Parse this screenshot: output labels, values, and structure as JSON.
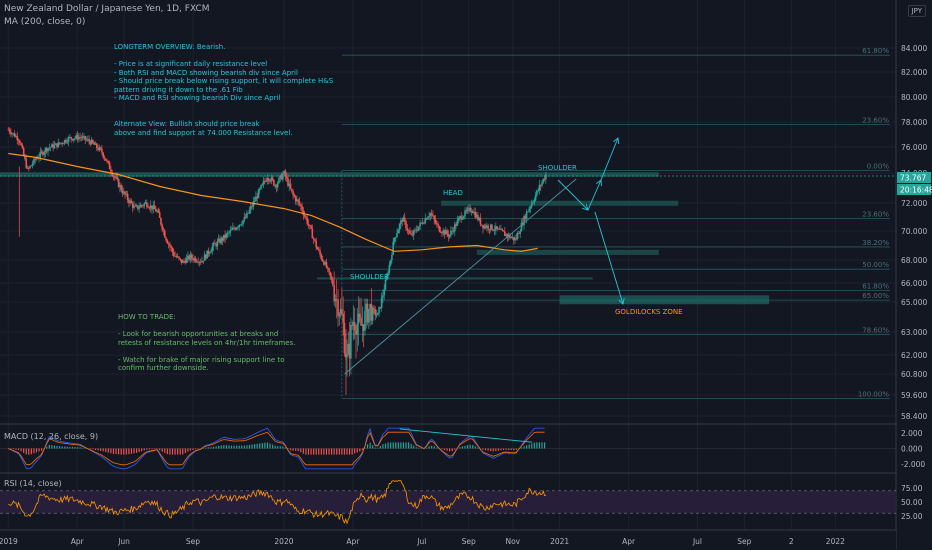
{
  "header": {
    "symbol_title": "New Zealand Dollar / Japanese Yen, 1D, FXCM",
    "ma_label": "MA (200, close, 0)",
    "currency": "JPY"
  },
  "price_axis": {
    "ticks": [
      "84.000",
      "82.000",
      "80.000",
      "78.000",
      "76.000",
      "74.000",
      "72.000",
      "70.000",
      "68.000",
      "66.000",
      "65.000",
      "63.000",
      "62.000",
      "60.800",
      "59.600",
      "58.400"
    ],
    "last_price": "73.767",
    "countdown": "20:16:48"
  },
  "time_axis": [
    "2019",
    "Apr",
    "Jun",
    "Sep",
    "2020",
    "Apr",
    "Jul",
    "Sep",
    "Nov",
    "2021",
    "Apr",
    "Jul",
    "Sep",
    "2",
    "2022"
  ],
  "fib_labels": [
    "61.80%",
    "23.60%",
    "0.00%",
    "23.60%",
    "38.20%",
    "50.00%",
    "61.80%",
    "65.00%",
    "78.60%",
    "100.00%"
  ],
  "annotations": {
    "overview_title": "LONGTERM OVERVIEW: Bearish.",
    "overview_lines": "- Price is at significant daily resistance level\n- Both RSI and MACD showing bearish div since April\n- Should price break below rising support, it will complete H&S\npattern driving it down to the .61 Fib\n- MACD and RSI showing bearish Div since April",
    "alt_view": "Alternate View: Bullish should price break\nabove and find support at 74.000 Resistance level.",
    "how_to_title": "HOW TO TRADE:",
    "how_to_lines": "- Look for bearish opportunities at breaks and\nretests of resistance levels on 4hr/1hr timeframes.\n\n- Watch for brake of major rising support line to\nconfirm further downside.",
    "shoulder_left": "SHOULDER",
    "head": "HEAD",
    "shoulder_right": "SHOULDER",
    "zone": "GOLDILOCKS ZONE"
  },
  "macd": {
    "label": "MACD (12, 26, close, 9)",
    "ticks": [
      "2.000",
      "0.000",
      "-2.000"
    ]
  },
  "rsi": {
    "label": "RSI (14, close)",
    "ticks": [
      "75.00",
      "50.00",
      "25.00"
    ]
  },
  "colors": {
    "background": "#131722",
    "up_candle": "#26a69a",
    "down_candle": "#ef5350",
    "ma": "#f7931a",
    "teal_text": "#26c6da",
    "green_text": "#66bb6a",
    "orange_text": "#ff9800",
    "rsi": "#ff9800",
    "rsi_bg": "#2a1f3d",
    "last_price_bg": "#26a69a",
    "countdown_bg": "#26a69a"
  },
  "chart_data": {
    "type": "candlestick",
    "series": [
      {
        "name": "MA (200, close, 0)",
        "values": []
      }
    ],
    "price_ylim": [
      57.5,
      85.5
    ],
    "price_path": [
      [
        2019.0,
        77.4
      ],
      [
        2019.04,
        76.6
      ],
      [
        2019.07,
        74.2
      ],
      [
        2019.1,
        75.1
      ],
      [
        2019.14,
        75.9
      ],
      [
        2019.18,
        76.2
      ],
      [
        2019.22,
        76.7
      ],
      [
        2019.26,
        76.8
      ],
      [
        2019.3,
        76.4
      ],
      [
        2019.34,
        75.6
      ],
      [
        2019.38,
        73.9
      ],
      [
        2019.42,
        72.6
      ],
      [
        2019.46,
        71.6
      ],
      [
        2019.5,
        72.0
      ],
      [
        2019.54,
        71.4
      ],
      [
        2019.57,
        69.6
      ],
      [
        2019.6,
        68.4
      ],
      [
        2019.63,
        67.8
      ],
      [
        2019.66,
        68.2
      ],
      [
        2019.7,
        67.9
      ],
      [
        2019.74,
        68.9
      ],
      [
        2019.78,
        69.5
      ],
      [
        2019.82,
        70.2
      ],
      [
        2019.86,
        70.9
      ],
      [
        2019.9,
        72.4
      ],
      [
        2019.94,
        73.8
      ],
      [
        2019.97,
        73.2
      ],
      [
        2020.0,
        74.0
      ],
      [
        2020.03,
        72.6
      ],
      [
        2020.06,
        71.8
      ],
      [
        2020.09,
        70.4
      ],
      [
        2020.12,
        68.8
      ],
      [
        2020.15,
        67.6
      ],
      [
        2020.18,
        65.8
      ],
      [
        2020.21,
        64.0
      ],
      [
        2020.23,
        61.5
      ],
      [
        2020.25,
        63.8
      ],
      [
        2020.28,
        63.4
      ],
      [
        2020.31,
        64.6
      ],
      [
        2020.34,
        64.1
      ],
      [
        2020.37,
        66.2
      ],
      [
        2020.4,
        69.5
      ],
      [
        2020.43,
        70.9
      ],
      [
        2020.46,
        69.6
      ],
      [
        2020.5,
        70.6
      ],
      [
        2020.53,
        71.3
      ],
      [
        2020.56,
        70.2
      ],
      [
        2020.6,
        69.7
      ],
      [
        2020.64,
        71.0
      ],
      [
        2020.68,
        71.6
      ],
      [
        2020.72,
        70.4
      ],
      [
        2020.76,
        70.2
      ],
      [
        2020.8,
        69.8
      ],
      [
        2020.84,
        69.4
      ],
      [
        2020.88,
        71.3
      ],
      [
        2020.92,
        72.8
      ],
      [
        2020.95,
        73.9
      ]
    ],
    "ma_path": [
      [
        2019.0,
        75.5
      ],
      [
        2019.1,
        75.2
      ],
      [
        2019.25,
        74.5
      ],
      [
        2019.4,
        73.9
      ],
      [
        2019.55,
        73.1
      ],
      [
        2019.7,
        72.5
      ],
      [
        2019.85,
        72.1
      ],
      [
        2020.0,
        71.6
      ],
      [
        2020.1,
        71.1
      ],
      [
        2020.2,
        70.3
      ],
      [
        2020.3,
        69.4
      ],
      [
        2020.4,
        68.6
      ],
      [
        2020.5,
        68.7
      ],
      [
        2020.6,
        68.9
      ],
      [
        2020.7,
        69.0
      ],
      [
        2020.8,
        68.7
      ],
      [
        2020.86,
        68.6
      ],
      [
        2020.92,
        68.8
      ]
    ],
    "levels": {
      "resistance_74": 74.0,
      "neckline": 72.0,
      "support_685": 68.5,
      "zone_low": 64.9,
      "zone_high": 65.3,
      "box_665": 66.4
    },
    "fib_levels": [
      {
        "label": "61.80%",
        "price": 83.4
      },
      {
        "label": "23.60%",
        "price": 77.8
      },
      {
        "label": "0.00%",
        "price": 74.2
      },
      {
        "label": "23.60%",
        "price": 70.9
      },
      {
        "label": "38.20%",
        "price": 68.9
      },
      {
        "label": "50.00%",
        "price": 67.2
      },
      {
        "label": "61.80%",
        "price": 65.6
      },
      {
        "label": "65.00%",
        "price": 65.1
      },
      {
        "label": "78.60%",
        "price": 62.9
      },
      {
        "label": "100.00%",
        "price": 59.4
      }
    ],
    "rsi_ylim": [
      0,
      100
    ],
    "rsi_levels": [
      70,
      30
    ],
    "macd_ylim": [
      -3,
      3
    ]
  }
}
